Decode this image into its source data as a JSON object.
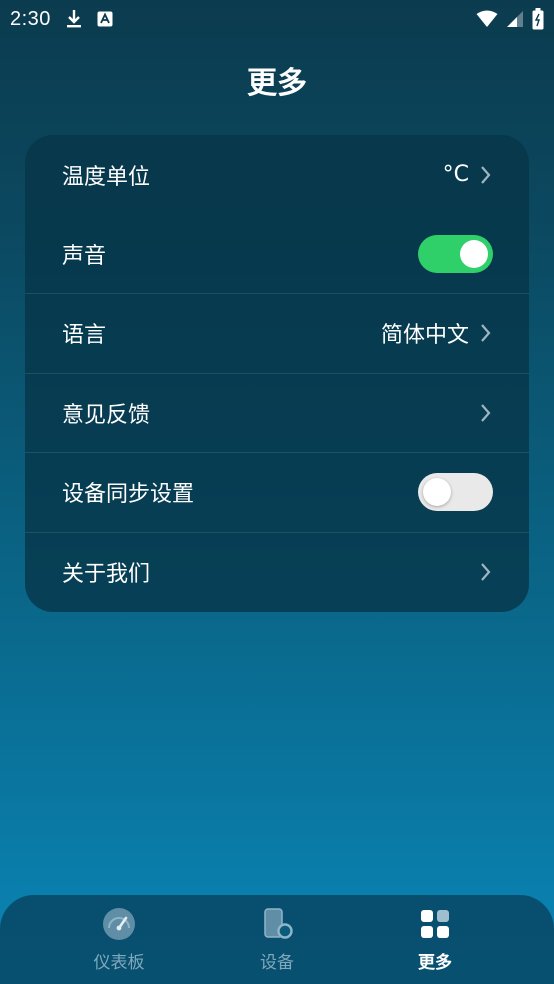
{
  "status_bar": {
    "time": "2:30",
    "icons": [
      "download-icon",
      "font-icon",
      "wifi-icon",
      "signal-icon",
      "battery-icon"
    ]
  },
  "header": {
    "title": "更多"
  },
  "settings": {
    "temperature_unit": {
      "label": "温度单位",
      "value": "°C"
    },
    "sound": {
      "label": "声音",
      "enabled": true
    },
    "language": {
      "label": "语言",
      "value": "简体中文"
    },
    "feedback": {
      "label": "意见反馈"
    },
    "device_sync": {
      "label": "设备同步设置",
      "enabled": false
    },
    "about": {
      "label": "关于我们"
    }
  },
  "bottom_nav": {
    "items": [
      {
        "label": "仪表板",
        "icon": "dashboard-icon",
        "active": false
      },
      {
        "label": "设备",
        "icon": "device-icon",
        "active": false
      },
      {
        "label": "更多",
        "icon": "grid-icon",
        "active": true
      }
    ]
  },
  "colors": {
    "toggle_on": "#2fd06a",
    "toggle_off": "#e9e9e9",
    "nav_inactive": "#7fa8bd",
    "nav_active": "#ffffff"
  }
}
